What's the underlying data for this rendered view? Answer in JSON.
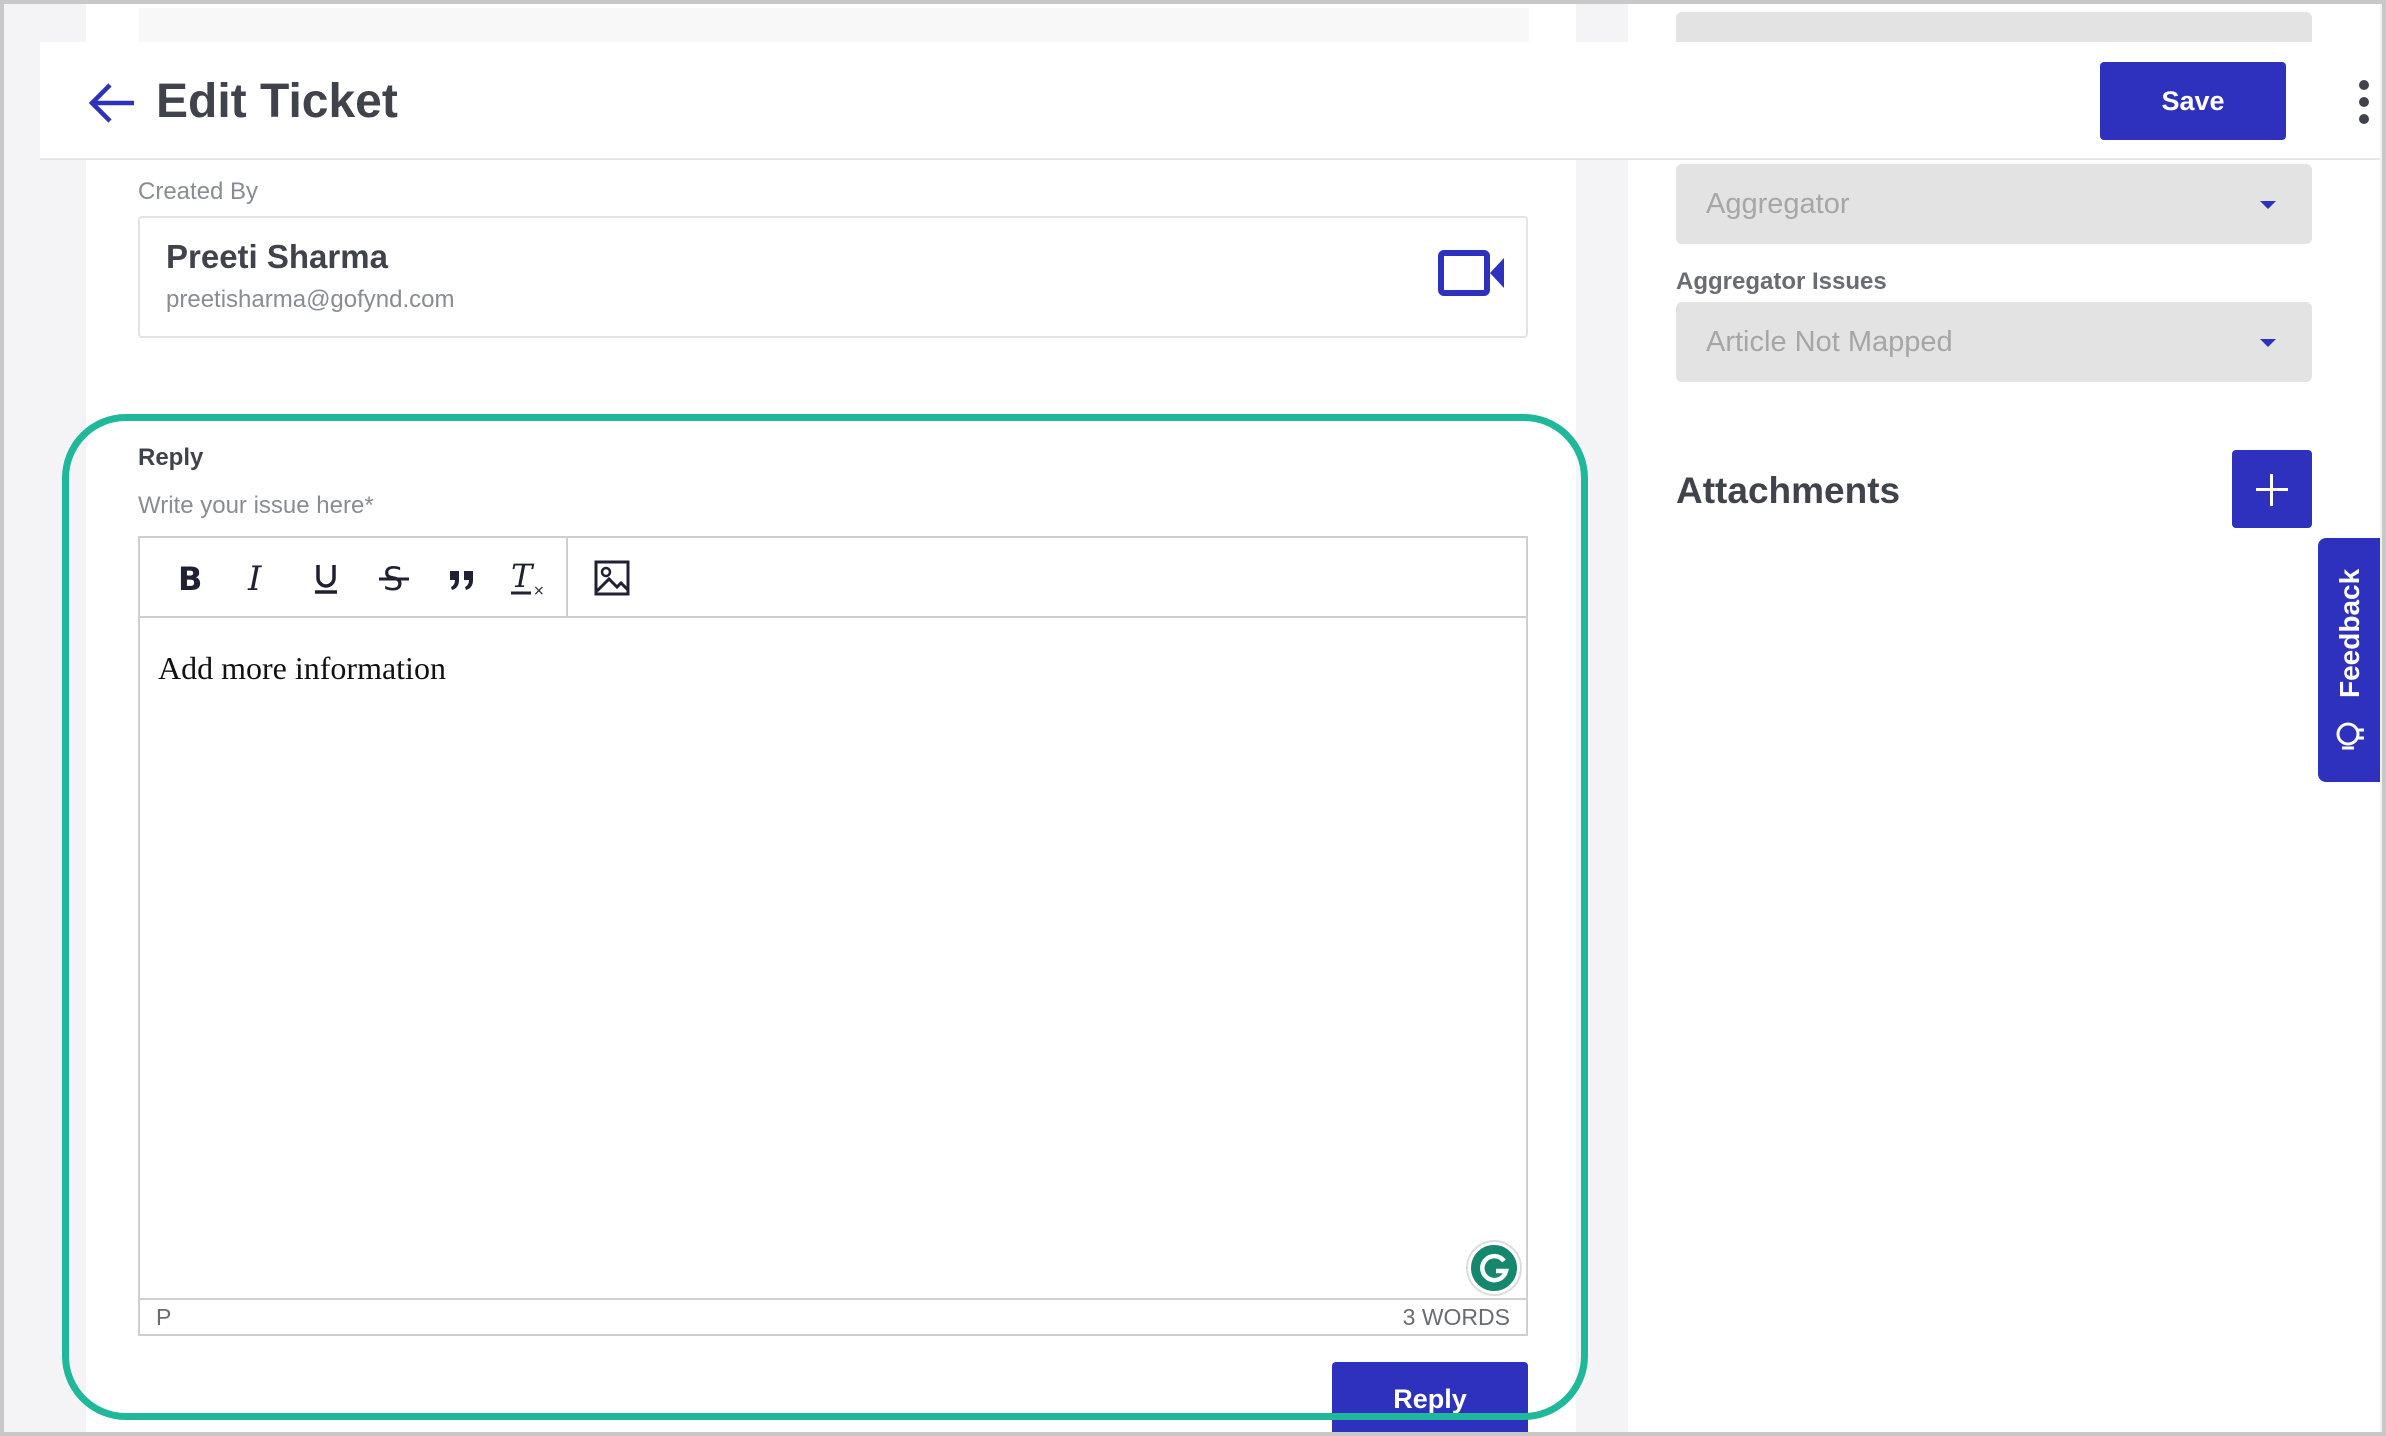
{
  "header": {
    "title": "Edit Ticket",
    "save_label": "Save"
  },
  "created_by": {
    "label": "Created By",
    "name": "Preeti Sharma",
    "email": "preetisharma@gofynd.com"
  },
  "side_fields": {
    "aggregator_value": "Aggregator",
    "issues_label": "Aggregator Issues",
    "issues_value": "Article Not Mapped"
  },
  "attachments": {
    "title": "Attachments"
  },
  "feedback": {
    "label": "Feedback"
  },
  "reply": {
    "label": "Reply",
    "hint": "Write your issue here*",
    "content": "Add more information",
    "path": "P",
    "word_count": "3 WORDS",
    "button_label": "Reply"
  },
  "colors": {
    "primary": "#2e31be",
    "highlight": "#1fb89a",
    "grammarly": "#15876d"
  },
  "icons": {
    "back": "arrow-left-icon",
    "more": "kebab-menu-icon",
    "video": "video-camera-icon",
    "add": "plus-icon",
    "feedback": "lightbulb-icon",
    "toolbar": [
      "bold-icon",
      "italic-icon",
      "underline-icon",
      "strikethrough-icon",
      "quote-icon",
      "clear-format-icon",
      "image-icon"
    ],
    "grammarly": "grammarly-icon"
  }
}
